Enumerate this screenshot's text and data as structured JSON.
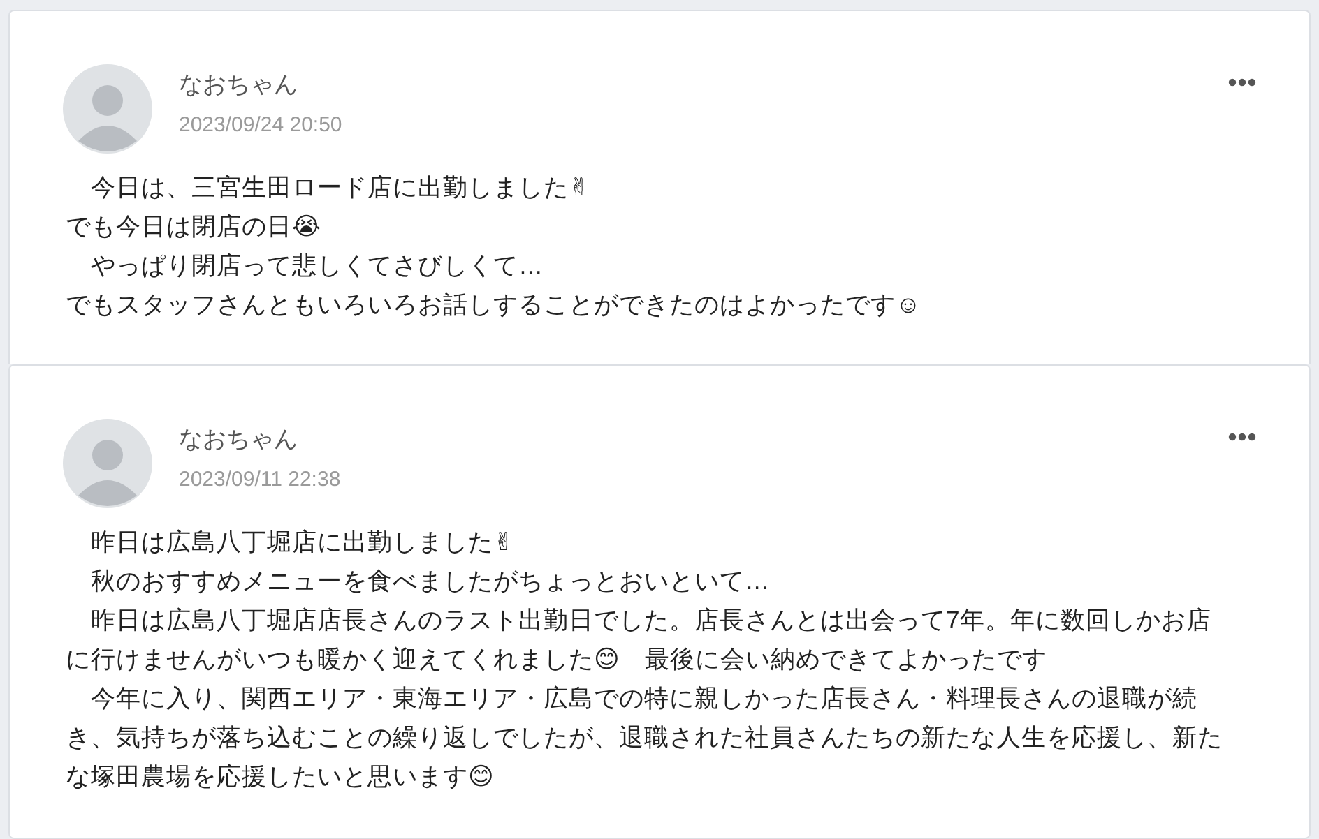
{
  "posts": [
    {
      "author": "なおちゃん",
      "date": "2023/09/24 20:50",
      "lines": [
        "　今日は、三宮生田ロード店に出勤しました✌",
        "でも今日は閉店の日😭",
        "　やっぱり閉店って悲しくてさびしくて…",
        "でもスタッフさんともいろいろお話しすることができたのはよかったです☺"
      ]
    },
    {
      "author": "なおちゃん",
      "date": "2023/09/11 22:38",
      "lines": [
        "　昨日は広島八丁堀店に出勤しました✌",
        "　秋のおすすめメニューを食べましたがちょっとおいといて…",
        "　昨日は広島八丁堀店店長さんのラスト出勤日でした。店長さんとは出会って7年。年に数回しかお店",
        "に行けませんがいつも暖かく迎えてくれました😊　最後に会い納めできてよかったです",
        "　今年に入り、関西エリア・東海エリア・広島での特に親しかった店長さん・料理長さんの退職が続",
        "き、気持ちが落ち込むことの繰り返しでしたが、退職された社員さんたちの新たな人生を応援し、新た",
        "な塚田農場を応援したいと思います😊"
      ]
    }
  ]
}
